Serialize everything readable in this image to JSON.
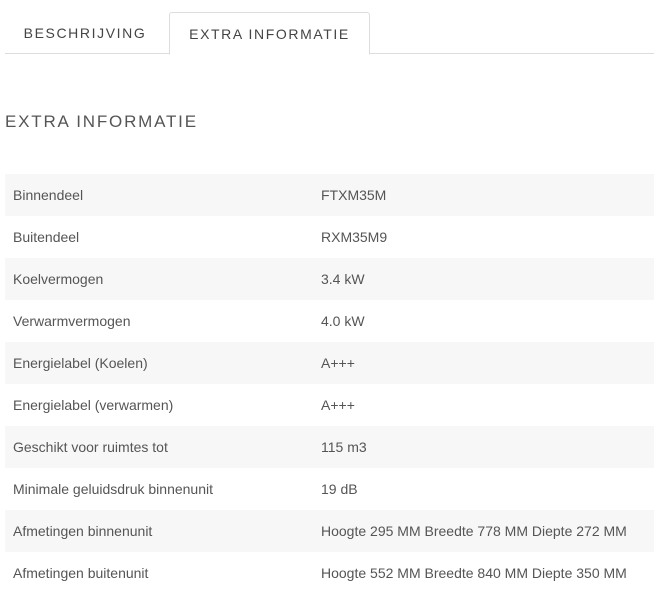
{
  "tabs": [
    {
      "label": "BESCHRIJVING",
      "active": false
    },
    {
      "label": "EXTRA INFORMATIE",
      "active": true
    }
  ],
  "section": {
    "title": "EXTRA INFORMATIE"
  },
  "attributes": [
    {
      "label": "Binnendeel",
      "value": "FTXM35M"
    },
    {
      "label": "Buitendeel",
      "value": "RXM35M9"
    },
    {
      "label": "Koelvermogen",
      "value": "3.4 kW"
    },
    {
      "label": "Verwarmvermogen",
      "value": "4.0 kW"
    },
    {
      "label": "Energielabel (Koelen)",
      "value": "A+++"
    },
    {
      "label": "Energielabel (verwarmen)",
      "value": "A+++"
    },
    {
      "label": "Geschikt voor ruimtes tot",
      "value": "115 m3"
    },
    {
      "label": "Minimale geluidsdruk binnenunit",
      "value": "19 dB"
    },
    {
      "label": "Afmetingen binnenunit",
      "value": "Hoogte 295 MM Breedte 778 MM Diepte 272 MM"
    },
    {
      "label": "Afmetingen buitenunit",
      "value": "Hoogte 552 MM Breedte 840 MM Diepte 350 MM"
    }
  ]
}
